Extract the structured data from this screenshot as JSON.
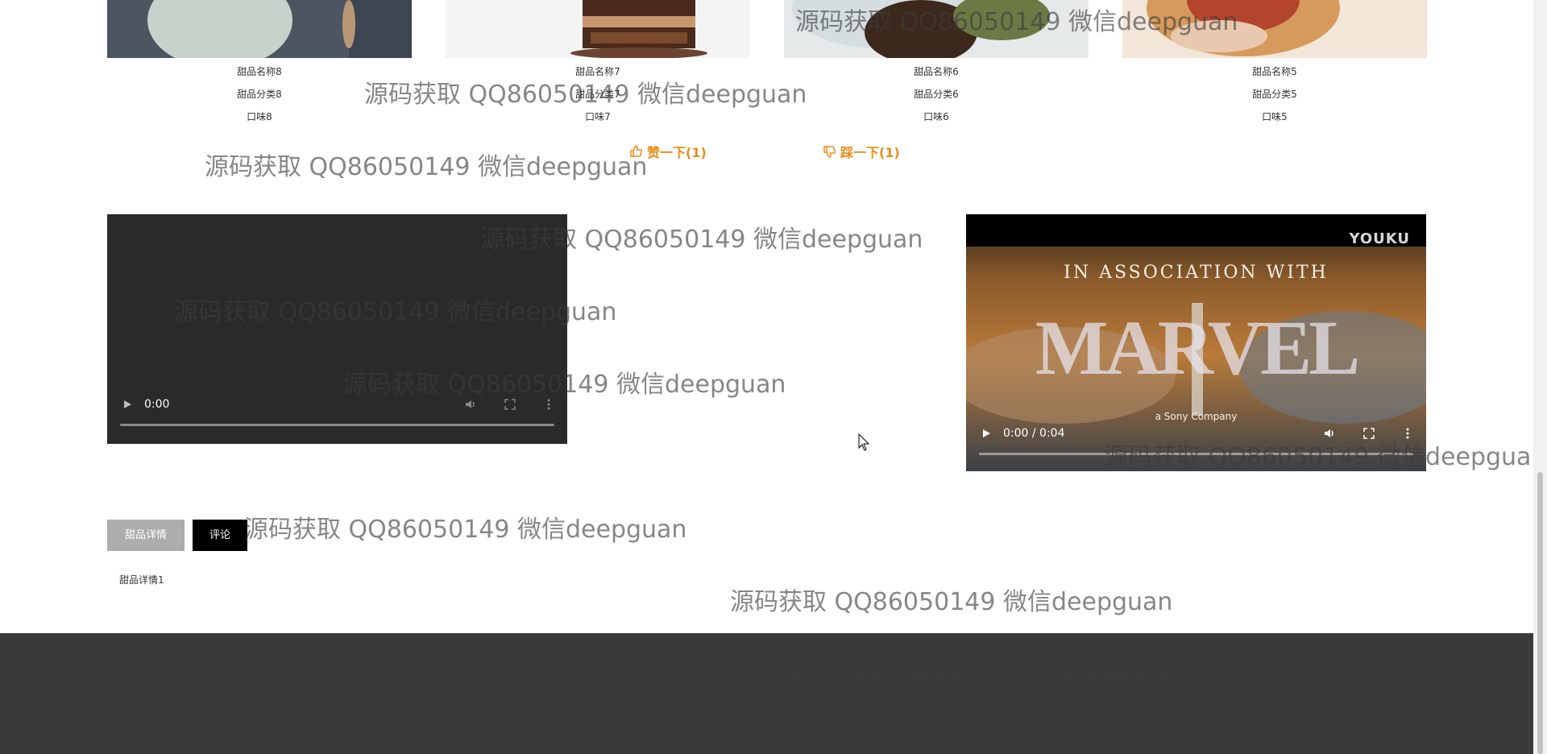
{
  "cards": [
    {
      "name": "甜品名称8",
      "category": "甜品分类8",
      "taste": "口味8"
    },
    {
      "name": "甜品名称7",
      "category": "甜品分类7",
      "taste": "口味7"
    },
    {
      "name": "甜品名称6",
      "category": "甜品分类6",
      "taste": "口味6"
    },
    {
      "name": "甜品名称5",
      "category": "甜品分类5",
      "taste": "口味5"
    }
  ],
  "votes": {
    "like_label": "赞一下(1)",
    "dislike_label": "踩一下(1)"
  },
  "video1": {
    "time": "0:00",
    "progress": 0
  },
  "video2": {
    "time": "0:00 / 0:04",
    "progress": 0,
    "logo": "YOUKU",
    "line1": "IN ASSOCIATION WITH",
    "line2": "MARVEL",
    "line3": "a Sony Company"
  },
  "tabs": {
    "detail_label": "甜品详情",
    "comment_label": "评论"
  },
  "detail": {
    "text": "甜品详情1"
  },
  "watermark": "源码获取 QQ86050149 微信deepguan",
  "icons": [
    "thumbs-up-icon",
    "thumbs-down-icon",
    "play-icon",
    "volume-icon",
    "fullscreen-icon",
    "more-vert-icon",
    "cursor-icon"
  ],
  "colors": {
    "vote": "#e88d18",
    "footer": "#3a3a3a",
    "tab_detail": "#adadad",
    "tab_comment": "#000000"
  }
}
